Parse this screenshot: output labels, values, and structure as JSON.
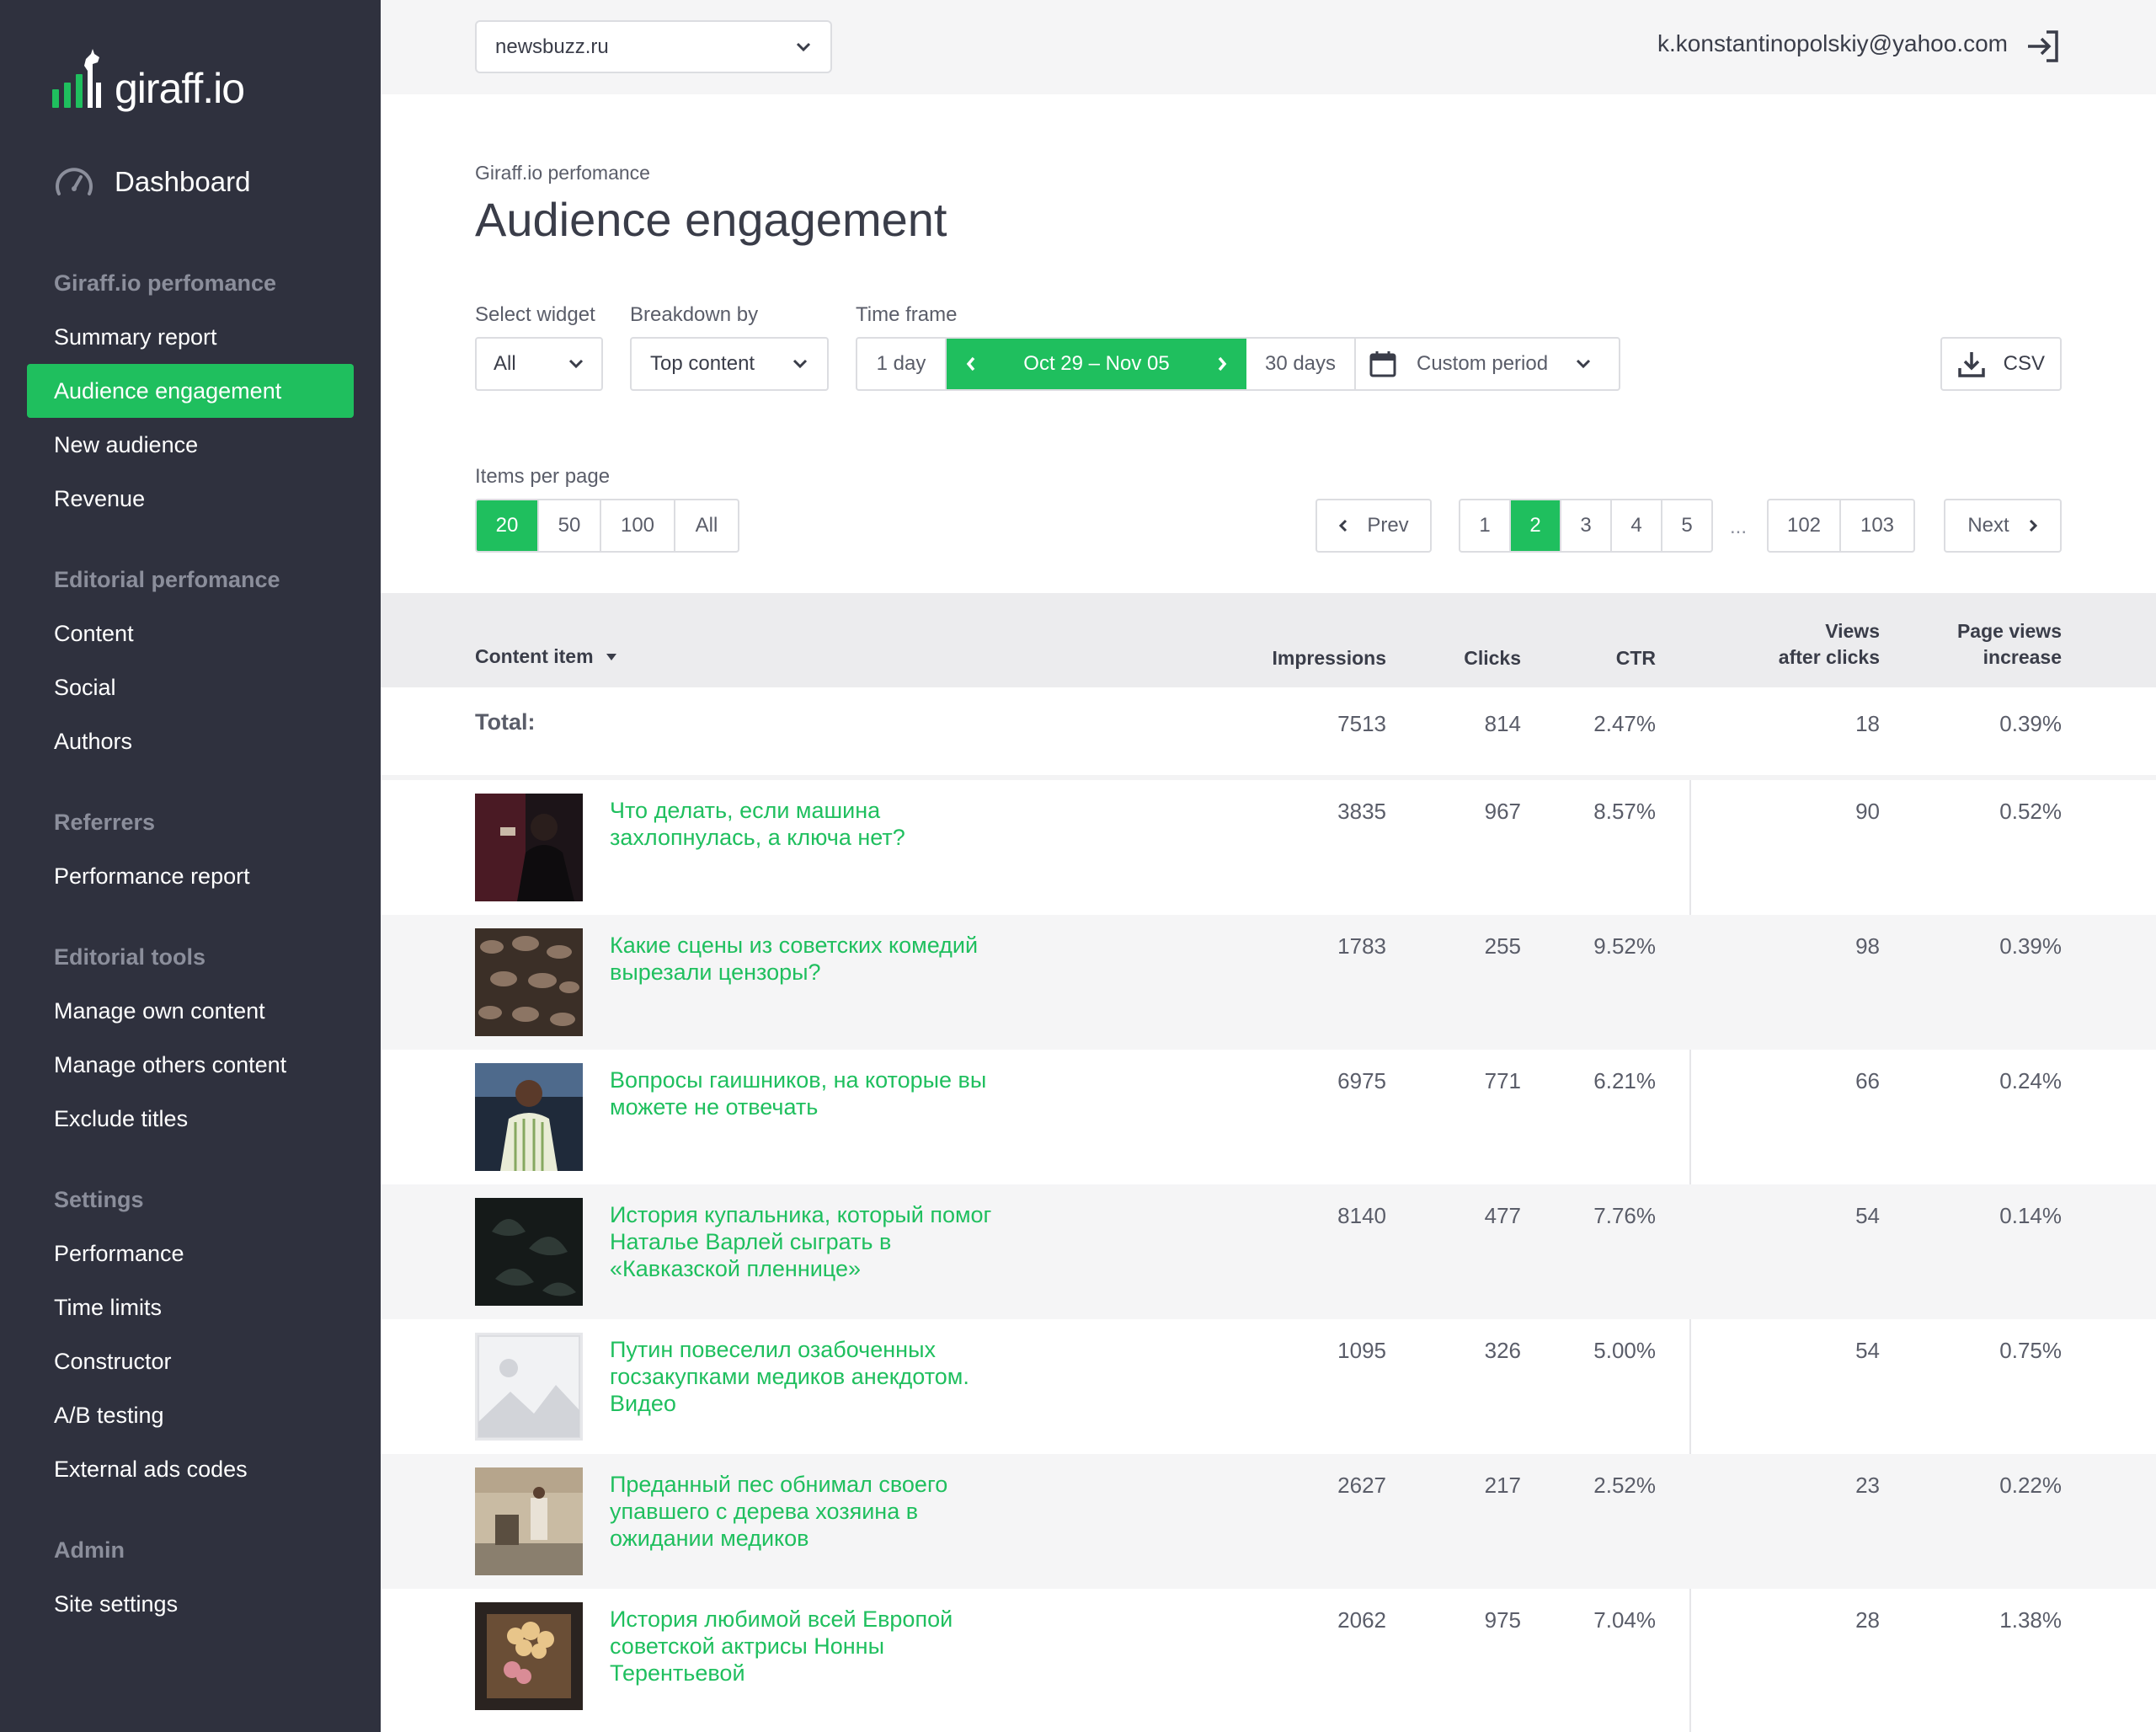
{
  "brand": {
    "name": "giraff.io",
    "accent": "#1fbf5e"
  },
  "sidebar": {
    "dashboard_label": "Dashboard",
    "groups": [
      {
        "header": "Giraff.io perfomance",
        "items": [
          "Summary report",
          "Audience engagement",
          "New audience",
          "Revenue"
        ]
      },
      {
        "header": "Editorial perfomance",
        "items": [
          "Content",
          "Social",
          "Authors"
        ]
      },
      {
        "header": "Referrers",
        "items": [
          "Performance report"
        ]
      },
      {
        "header": "Editorial tools",
        "items": [
          "Manage own content",
          "Manage others content",
          "Exclude titles"
        ]
      },
      {
        "header": "Settings",
        "items": [
          "Performance",
          "Time limits",
          "Constructor",
          "A/B testing",
          "External ads codes"
        ]
      },
      {
        "header": "Admin",
        "items": [
          "Site settings"
        ]
      }
    ],
    "active_item": "Audience engagement"
  },
  "topbar": {
    "site": "newsbuzz.ru",
    "email": "k.konstantinopolskiy@yahoo.com"
  },
  "page": {
    "breadcrumb": "Giraff.io perfomance",
    "title": "Audience engagement"
  },
  "controls": {
    "widget_label": "Select widget",
    "widget_value": "All",
    "breakdown_label": "Breakdown by",
    "breakdown_value": "Top content",
    "timeframe_label": "Time frame",
    "tf_1day": "1 day",
    "tf_range": "Oct 29 – Nov 05",
    "tf_30days": "30 days",
    "tf_custom": "Custom period",
    "csv_label": "CSV",
    "items_per_page_label": "Items per page",
    "ipp_options": [
      "20",
      "50",
      "100",
      "All"
    ],
    "ipp_active": "20"
  },
  "pagination": {
    "prev": "Prev",
    "next": "Next",
    "pages": [
      "1",
      "2",
      "3",
      "4",
      "5"
    ],
    "ellipsis": "...",
    "last_pages": [
      "102",
      "103"
    ],
    "active": "2"
  },
  "table": {
    "columns": {
      "content": "Content item",
      "impressions": "Impressions",
      "clicks": "Clicks",
      "ctr": "CTR",
      "views_after_clicks_1": "Views",
      "views_after_clicks_2": "after clicks",
      "page_views_increase_1": "Page views",
      "page_views_increase_2": "increase"
    },
    "total": {
      "label": "Total:",
      "impressions": "7513",
      "clicks": "814",
      "ctr": "2.47%",
      "views": "18",
      "increase": "0.39%"
    },
    "rows": [
      {
        "title": "Что делать, если машина захлопнулась, а ключа нет?",
        "impressions": "3835",
        "clicks": "967",
        "ctr": "8.57%",
        "views": "90",
        "increase": "0.52%"
      },
      {
        "title": "Какие сцены из советских комедий вырезали цензоры?",
        "impressions": "1783",
        "clicks": "255",
        "ctr": "9.52%",
        "views": "98",
        "increase": "0.39%"
      },
      {
        "title": "Вопросы гаишников, на которые вы можете не отвечать",
        "impressions": "6975",
        "clicks": "771",
        "ctr": "6.21%",
        "views": "66",
        "increase": "0.24%"
      },
      {
        "title": "История купальника, который помог Наталье Варлей сыграть в «Кавказской пленнице»",
        "impressions": "8140",
        "clicks": "477",
        "ctr": "7.76%",
        "views": "54",
        "increase": "0.14%"
      },
      {
        "title": "Путин повеселил озабоченных госзакупками медиков анекдотом. Видео",
        "impressions": "1095",
        "clicks": "326",
        "ctr": "5.00%",
        "views": "54",
        "increase": "0.75%"
      },
      {
        "title": "Преданный пес обнимал своего упавшего с дерева хозяина в ожидании медиков",
        "impressions": "2627",
        "clicks": "217",
        "ctr": "2.52%",
        "views": "23",
        "increase": "0.22%"
      },
      {
        "title": "История любимой всей Европой советской актрисы Нонны Терентьевой",
        "impressions": "2062",
        "clicks": "975",
        "ctr": "7.04%",
        "views": "28",
        "increase": "1.38%"
      }
    ]
  }
}
